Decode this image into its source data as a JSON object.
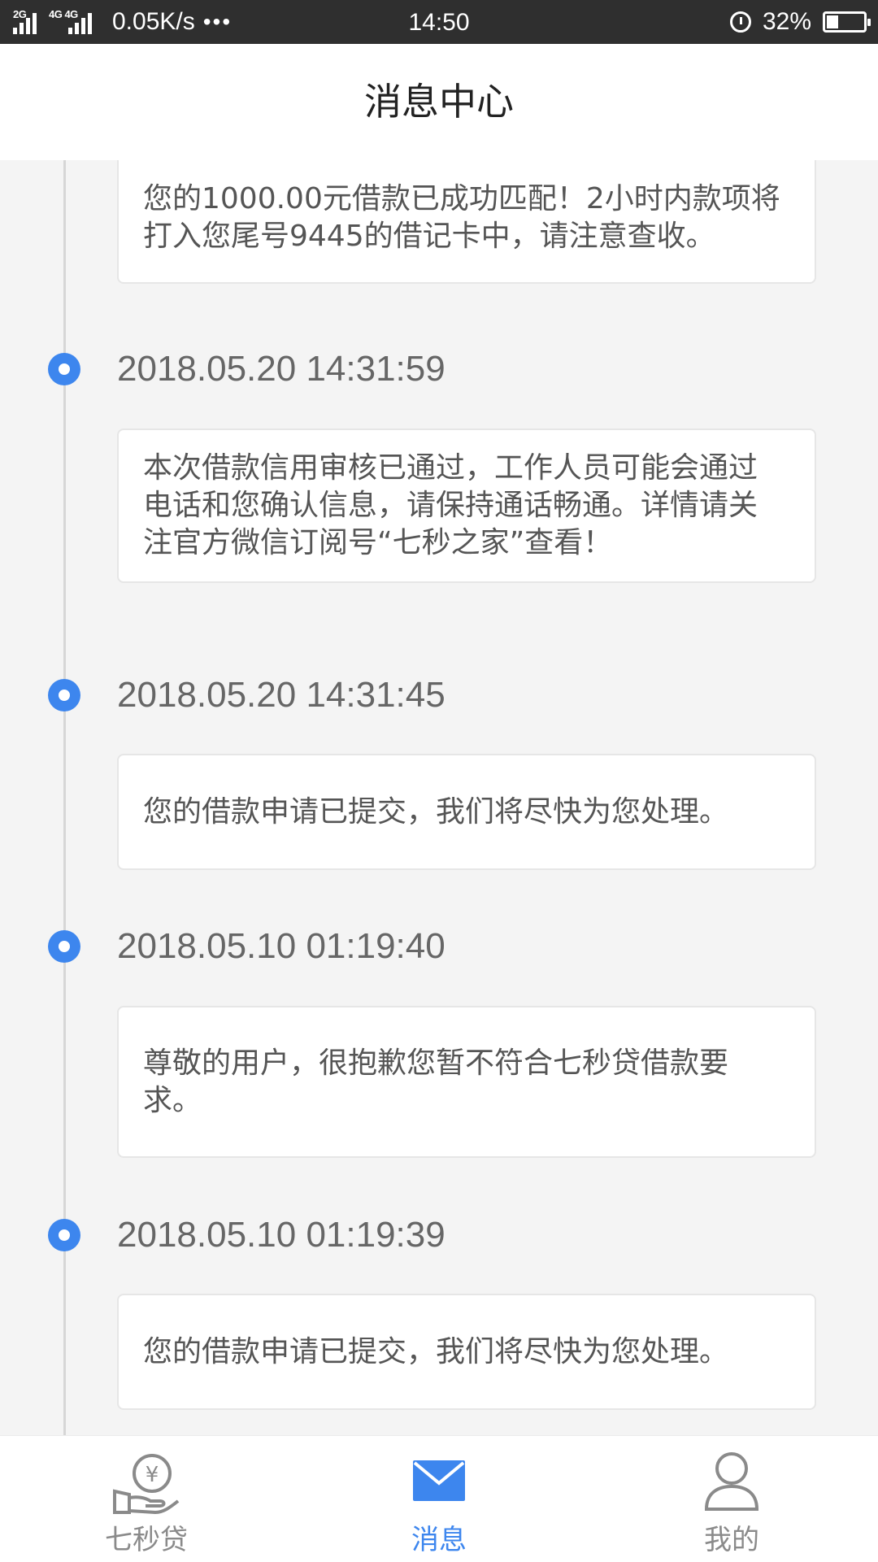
{
  "status_bar": {
    "signal1_tag": "2G",
    "signal2_tag": "4G 4G",
    "speed": "0.05K/s",
    "dots": "•••",
    "time": "14:50",
    "battery": "32%",
    "battery_level": 0.32
  },
  "header": {
    "title": "消息中心"
  },
  "messages": [
    {
      "timestamp": "",
      "text": "您的1000.00元借款已成功匹配！2小时内款项将打入您尾号9445的借记卡中，请注意查收。"
    },
    {
      "timestamp": "2018.05.20 14:31:59",
      "text": "本次借款信用审核已通过，工作人员可能会通过电话和您确认信息，请保持通话畅通。详情请关注官方微信订阅号“七秒之家”查看！"
    },
    {
      "timestamp": "2018.05.20 14:31:45",
      "text": "您的借款申请已提交，我们将尽快为您处理。"
    },
    {
      "timestamp": "2018.05.10 01:19:40",
      "text": "尊敬的用户，很抱歉您暂不符合七秒贷借款要求。"
    },
    {
      "timestamp": "2018.05.10 01:19:39",
      "text": "您的借款申请已提交，我们将尽快为您处理。"
    }
  ],
  "tabbar": {
    "tabs": [
      {
        "label": "七秒贷",
        "icon": "money-hand-icon",
        "active": false
      },
      {
        "label": "消息",
        "icon": "mail-icon",
        "active": true
      },
      {
        "label": "我的",
        "icon": "user-icon",
        "active": false
      }
    ],
    "colors": {
      "active": "#3d86ee",
      "inactive": "#8a8a8a"
    }
  }
}
